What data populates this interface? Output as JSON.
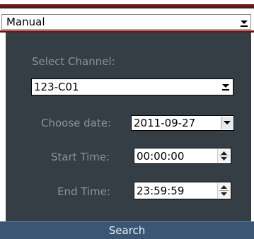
{
  "mode_select": {
    "value": "Manual",
    "arrow_icon": "chevron-down-icon"
  },
  "channel": {
    "label": "Select Channel:",
    "value": "123-C01",
    "arrow_icon": "chevron-down-icon"
  },
  "date": {
    "label": "Choose date:",
    "value": "2011-09-27",
    "arrow_icon": "chevron-down-icon"
  },
  "start_time": {
    "label": "Start Time:",
    "value": "00:00:00",
    "spinner_icon": "spinner-icon"
  },
  "end_time": {
    "label": "End Time:",
    "value": "23:59:59",
    "spinner_icon": "spinner-icon"
  },
  "search": {
    "label": "Search"
  },
  "colors": {
    "panel_bg": "#353d45",
    "label_text": "#8c939a",
    "accent_red": "#7a1010",
    "search_bar": "#3a5673"
  }
}
